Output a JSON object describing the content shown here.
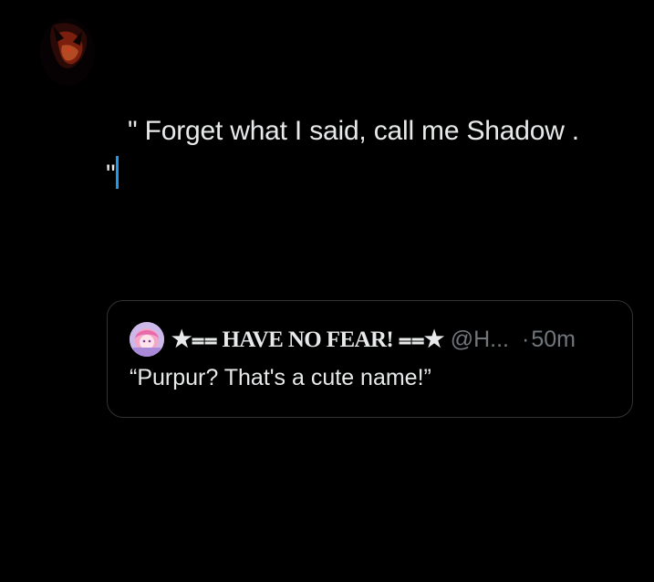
{
  "compose": {
    "line1": "\" Forget what I said, call me Shadow .",
    "line2": "\""
  },
  "quoted_post": {
    "display_name": "★⩵ HAVE NO FEAR! ⩵★",
    "handle": "@H...",
    "separator": "·",
    "time": "50m",
    "text": "“Purpur? That's a cute name!”"
  },
  "colors": {
    "background": "#000000",
    "text_primary": "#e7e9ea",
    "text_secondary": "#71767b",
    "caret": "#1d9bf0",
    "card_border": "#2f3336"
  }
}
